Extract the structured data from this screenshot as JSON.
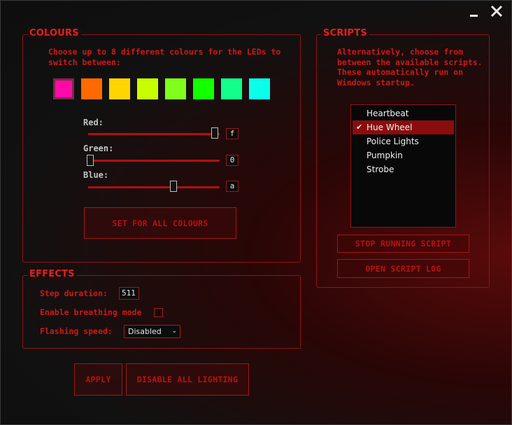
{
  "window": {
    "minimize_icon": "minimize-icon",
    "close_icon": "close-icon"
  },
  "colours": {
    "legend": "COLOURS",
    "description": "Choose up to 8 different colours for the LEDs to switch between:",
    "swatches": [
      "#ff0aa8",
      "#ff6a00",
      "#ffd500",
      "#c8ff00",
      "#80ff1a",
      "#12ff00",
      "#12ff8c",
      "#0affea"
    ],
    "selected_swatch": 0,
    "red": {
      "label": "Red:",
      "value": "f",
      "level": 1.0
    },
    "green": {
      "label": "Green:",
      "value": "0",
      "level": 0.0
    },
    "blue": {
      "label": "Blue:",
      "value": "a",
      "level": 0.667
    },
    "set_all_label": "SET FOR ALL COLOURS"
  },
  "effects": {
    "legend": "EFFECTS",
    "step_duration_label": "Step duration:",
    "step_duration_value": "511",
    "breathing_label": "Enable breathing mode",
    "breathing_checked": false,
    "flashing_label": "Flashing speed:",
    "flashing_value": "Disabled"
  },
  "scripts": {
    "legend": "SCRIPTS",
    "description": "Alternatively, choose from between the available scripts. These automatically run on Windows startup.",
    "items": [
      "Heartbeat",
      "Hue Wheel",
      "Police Lights",
      "Pumpkin",
      "Strobe"
    ],
    "selected_index": 1,
    "stop_label": "STOP RUNNING SCRIPT",
    "log_label": "OPEN SCRIPT LOG"
  },
  "footer": {
    "apply_label": "APPLY",
    "disable_label": "DISABLE ALL LIGHTING"
  }
}
